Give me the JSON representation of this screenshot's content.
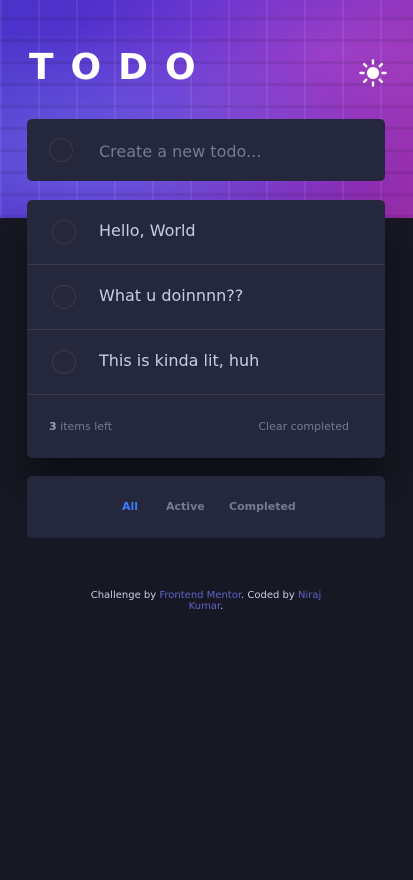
{
  "app": {
    "title": "TODO",
    "theme_toggle_icon": "sun-icon"
  },
  "new_todo": {
    "placeholder": "Create a new todo...",
    "value": ""
  },
  "todos": [
    {
      "text": "Hello, World",
      "completed": false
    },
    {
      "text": "What u doinnnn??",
      "completed": false
    },
    {
      "text": "This is kinda lit, huh",
      "completed": false
    }
  ],
  "footer": {
    "count": "3",
    "count_suffix": "items left",
    "clear_label": "Clear completed"
  },
  "filters": {
    "all": "All",
    "active": "Active",
    "completed": "Completed",
    "selected": "All"
  },
  "attribution": {
    "prefix": "Challenge by",
    "frontend_link": "Frontend Mentor",
    "middle": ". Coded by",
    "author_link": "Niraj Kumar",
    "suffix": "."
  },
  "colors": {
    "background": "#181824",
    "card": "#25273c",
    "active_filter": "#3a7bfd",
    "link": "#5e63c9"
  }
}
